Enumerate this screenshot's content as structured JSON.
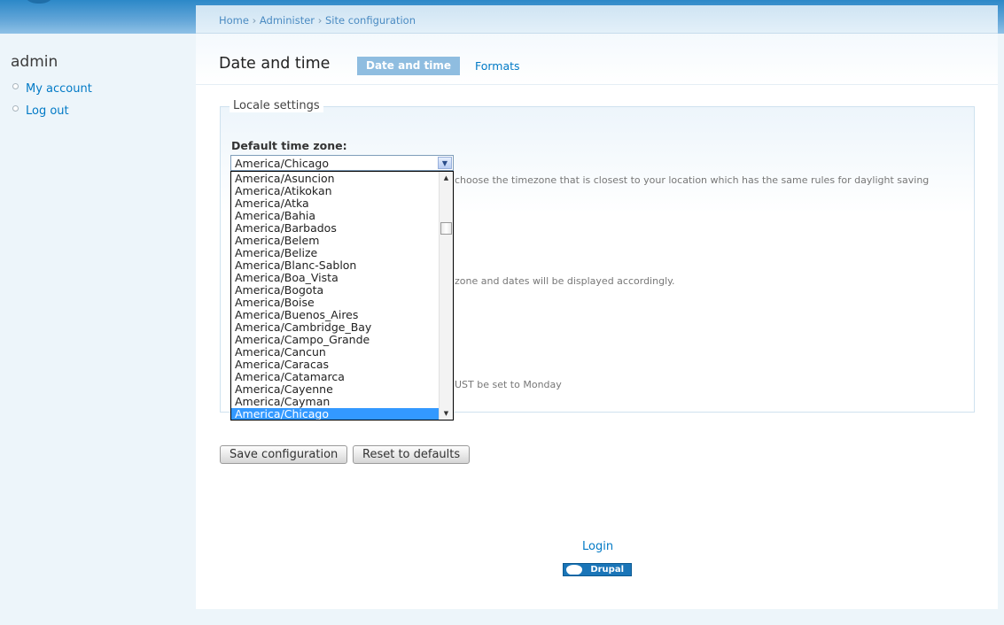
{
  "sidebar": {
    "username": "admin",
    "links": [
      "My account",
      "Log out"
    ]
  },
  "breadcrumb": {
    "items": [
      "Home",
      "Administer",
      "Site configuration"
    ],
    "separator": "›"
  },
  "page": {
    "title": "Date and time",
    "tabs": [
      "Date and time",
      "Formats"
    ]
  },
  "fieldset": {
    "legend": "Locale settings",
    "tz_label": "Default time zone:",
    "desc_timezone": "choose the timezone that is closest to your location which has the same rules for daylight saving",
    "desc_zone": "zone and dates will be displayed accordingly.",
    "desc_monday": "UST be set to Monday"
  },
  "select": {
    "value": "America/Chicago",
    "options": [
      "America/Asuncion",
      "America/Atikokan",
      "America/Atka",
      "America/Bahia",
      "America/Barbados",
      "America/Belem",
      "America/Belize",
      "America/Blanc-Sablon",
      "America/Boa_Vista",
      "America/Bogota",
      "America/Boise",
      "America/Buenos_Aires",
      "America/Cambridge_Bay",
      "America/Campo_Grande",
      "America/Cancun",
      "America/Caracas",
      "America/Catamarca",
      "America/Cayenne",
      "America/Cayman",
      "America/Chicago"
    ],
    "selected_index": 19
  },
  "buttons": {
    "save": "Save configuration",
    "reset": "Reset to defaults"
  },
  "footer": {
    "login": "Login",
    "badge": "Drupal"
  },
  "icons": {
    "select_arrow": "▼",
    "scroll_up": "▲",
    "scroll_down": "▼",
    "bullet": "circle-bullet-icon"
  },
  "colors": {
    "link": "#027ac6",
    "active_tab": "#8fbde0",
    "selection": "#3399ff"
  }
}
